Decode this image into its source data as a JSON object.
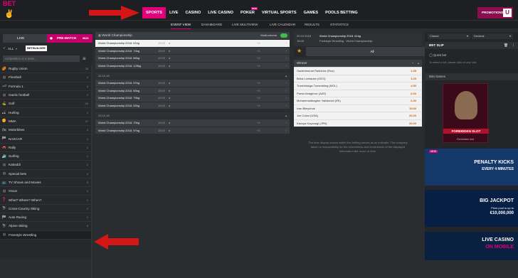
{
  "brand": {
    "logo_text": "BET",
    "logo_color": "#e0007a",
    "accent": "#e0007a"
  },
  "topnav": [
    {
      "label": "SPORTS",
      "active": true
    },
    {
      "label": "LIVE"
    },
    {
      "label": "CASINO"
    },
    {
      "label": "LIVE CASINO"
    },
    {
      "label": "POKER",
      "badge": "NEW"
    },
    {
      "label": "VIRTUAL SPORTS"
    },
    {
      "label": "GAMES"
    },
    {
      "label": "POOLS BETTING"
    }
  ],
  "promotions_label": "PROMOTIONS",
  "subnav": [
    "EVENT VIEW",
    "DASHBOARD",
    "LIVE MULTIVIEW",
    "LIVE CALENDAR",
    "RESULTS",
    "STATISTICS"
  ],
  "left": {
    "live_label": "LIVE",
    "prematch_label": "PRE-MATCH",
    "prematch_count": "5829",
    "filter_all": "ALL",
    "betbuilder_label": "BETBUILDER",
    "search_placeholder": "competition or a team...",
    "sports": [
      {
        "name": "Rugby Union",
        "count": "28"
      },
      {
        "name": "Floorball",
        "count": "2"
      },
      {
        "name": "Formula 1",
        "count": "4"
      },
      {
        "name": "Gaelic football",
        "count": "2"
      },
      {
        "name": "Golf",
        "count": "25"
      },
      {
        "name": "Hurling",
        "count": "1"
      },
      {
        "name": "MMA",
        "count": "47"
      },
      {
        "name": "Motorbikes",
        "count": "3"
      },
      {
        "name": "NASCAR",
        "count": "2"
      },
      {
        "name": "Rally",
        "count": "1"
      },
      {
        "name": "Surfing",
        "count": "1"
      },
      {
        "name": "Kabaddi",
        "count": "2"
      },
      {
        "name": "Special bets",
        "count": "2"
      },
      {
        "name": "TV Shows and Movies",
        "count": "3"
      },
      {
        "name": "Oscar",
        "count": "1"
      },
      {
        "name": "What? Where? When?",
        "count": "1"
      },
      {
        "name": "Cross-Country Skiing",
        "count": "2"
      },
      {
        "name": "Auto Racing",
        "count": "1"
      },
      {
        "name": "Alpine Skiing",
        "count": "6"
      },
      {
        "name": "Freestyle Wrestling",
        "count": ""
      }
    ]
  },
  "center": {
    "header": "World Championship",
    "multicolumn_label": "Multi-column",
    "groups": [
      {
        "date": "",
        "events": [
          {
            "name": "World Championship 2018. 61kg",
            "time": "15:00",
            "markets": "+1",
            "selected": true
          },
          {
            "name": "World Championship 2018. 74kg",
            "time": "15:00",
            "markets": "+1"
          },
          {
            "name": "World Championship 2018. 86kg",
            "time": "15:00",
            "markets": "+1"
          },
          {
            "name": "World Championship 2018. 125kg",
            "time": "15:00",
            "markets": "+1"
          }
        ]
      },
      {
        "date": "22.10.18",
        "events": [
          {
            "name": "World Championship 2018. 57kg",
            "time": "15:00",
            "markets": "+1"
          },
          {
            "name": "World Championship 2018. 65kg",
            "time": "15:00",
            "markets": "+1"
          },
          {
            "name": "World Championship 2018. 79kg",
            "time": "15:00",
            "markets": "+1"
          },
          {
            "name": "World Championship 2018. 92kg",
            "time": "15:00",
            "markets": "+1"
          }
        ]
      },
      {
        "date": "23.10.18",
        "events": [
          {
            "name": "World Championship 2018. 70kg",
            "time": "15:00",
            "markets": "+1"
          },
          {
            "name": "World Championship 2018. 97kg",
            "time": "15:00",
            "markets": "+1"
          }
        ]
      }
    ]
  },
  "event": {
    "date": "20.10.2018",
    "time": "15:00",
    "title": "World Championship 2018. 61kg",
    "subtitle": "Freestyle Wrestling . World Championship",
    "all_tab": "All",
    "market": "Winner",
    "runners": [
      {
        "name": "Gadzhimurad Rashidov (Rus)",
        "odd": "1.35"
      },
      {
        "name": "Beka Lomtadze (GEO)",
        "odd": "3.25"
      },
      {
        "name": "Tuvshintulga Tumenbileg (MGL)",
        "odd": "4.50"
      },
      {
        "name": "Parviz Ibragimov (AZE)",
        "odd": "6.00"
      },
      {
        "name": "Mohammadbagher Yakhkeshi (IRI)",
        "odd": "6.30"
      },
      {
        "name": "Ivan Bileychuk",
        "odd": "15.00"
      },
      {
        "name": "Joe Colon (USA)",
        "odd": "20.00"
      },
      {
        "name": "Kazuya Koyanagi (JPN)",
        "odd": "20.00"
      }
    ],
    "note": "The time display shown within live betting serves as an indicator. The company takes no responsibility for the correctness and currentness of the displayed information like score or time."
  },
  "right": {
    "odds_type": "Classic",
    "odds_format": "Decimal",
    "betslip_label": "BET SLIP",
    "quickbet_label": "Quick bet",
    "quickbet_note": "To select a bet, please click on any odd.",
    "minigames_label": "Mini Games",
    "game_title": "FORBIDDEN SLOT",
    "game_caption": "Forbidden slot",
    "banner1_badge": "NEW",
    "banner1_title": "PENALTY KICKS",
    "banner1_sub": "EVERY 4 MINUTES",
    "banner2_title": "BIG JACKPOT",
    "banner2_sub": "Prize pool is up to",
    "banner2_amount": "€10,000,000",
    "banner3_title": "LIVE CASINO",
    "banner3_sub": "ON MOBILE"
  }
}
